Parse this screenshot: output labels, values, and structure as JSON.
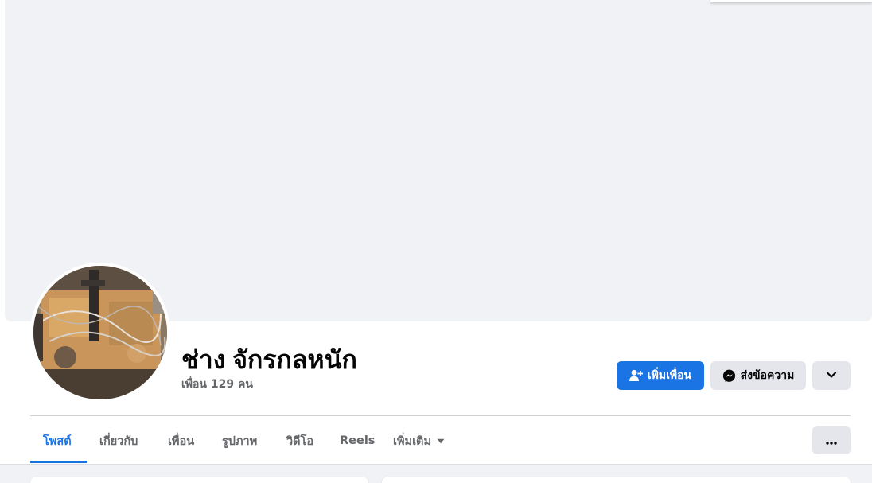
{
  "profile": {
    "name": "ช่าง จักรกลหนัก",
    "friend_count": "เพื่อน 129 คน",
    "avatar_icon": "engine-photo-avatar"
  },
  "actions": {
    "add_friend_label": "เพิ่มเพื่อน",
    "add_friend_icon": "add-person-icon",
    "message_label": "ส่งข้อความ",
    "message_icon": "messenger-icon",
    "dropdown_icon": "chevron-down-icon"
  },
  "tabs": [
    {
      "label": "โพสต์",
      "active": true
    },
    {
      "label": "เกี่ยวกับ",
      "active": false
    },
    {
      "label": "เพื่อน",
      "active": false
    },
    {
      "label": "รูปภาพ",
      "active": false
    },
    {
      "label": "วิดีโอ",
      "active": false
    },
    {
      "label": "Reels",
      "active": false
    },
    {
      "label": "เพิ่มเติม",
      "active": false,
      "icon": "caret-down-icon"
    }
  ],
  "more_options_icon": "ellipsis-icon",
  "colors": {
    "accent": "#1b74e4",
    "page_background": "#f0f2f5",
    "secondary_button": "#e4e6eb",
    "muted_text": "#65676b"
  }
}
